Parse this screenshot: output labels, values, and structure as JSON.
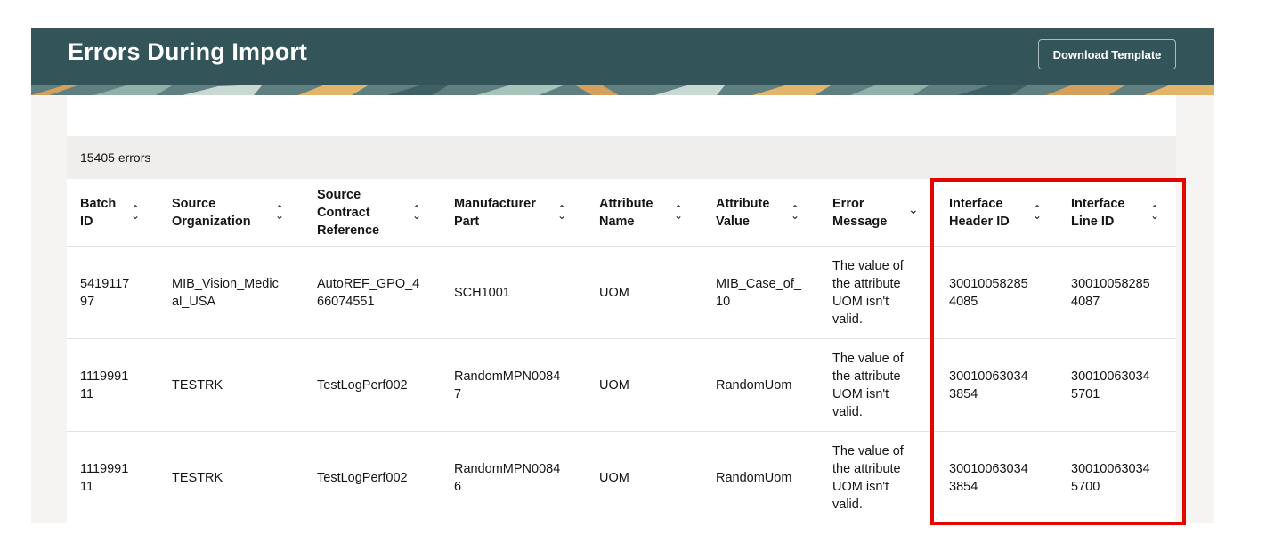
{
  "header": {
    "title": "Errors During Import",
    "download_label": "Download Template"
  },
  "summary": {
    "count_label": "15405 errors"
  },
  "table": {
    "columns": [
      {
        "label": "Batch\nID",
        "sort_icon": "⌃⌄"
      },
      {
        "label": "Source\nOrganization",
        "sort_icon": "⌃⌄"
      },
      {
        "label": "Source\nContract\nReference",
        "sort_icon": "⌃⌄"
      },
      {
        "label": "Manufacturer\nPart",
        "sort_icon": "⌃⌄"
      },
      {
        "label": "Attribute\nName",
        "sort_icon": "⌃⌄"
      },
      {
        "label": "Attribute\nValue",
        "sort_icon": "⌃⌄"
      },
      {
        "label": "Error\nMessage",
        "sort_icon": "⌄"
      },
      {
        "label": "Interface\nHeader ID",
        "sort_icon": "⌃⌄"
      },
      {
        "label": "Interface\nLine ID",
        "sort_icon": "⌃⌄"
      }
    ],
    "rows": [
      [
        "5419117\n97",
        "MIB_Vision_Medic\nal_USA",
        "AutoREF_GPO_4\n66074551",
        "SCH1001",
        "UOM",
        "MIB_Case_of_\n10",
        "The value of\nthe attribute\nUOM isn't\nvalid.",
        "30010058285\n4085",
        "30010058285\n4087"
      ],
      [
        "1119991\n11",
        "TESTRK",
        "TestLogPerf002",
        "RandomMPN0084\n7",
        "UOM",
        "RandomUom",
        "The value of\nthe attribute\nUOM isn't\nvalid.",
        "30010063034\n3854",
        "30010063034\n5701"
      ],
      [
        "1119991\n11",
        "TESTRK",
        "TestLogPerf002",
        "RandomMPN0084\n6",
        "UOM",
        "RandomUom",
        "The value of\nthe attribute\nUOM isn't\nvalid.",
        "30010063034\n3854",
        "30010063034\n5700"
      ]
    ]
  },
  "colors": {
    "header_bg": "#33555a",
    "highlight": "#e10600",
    "count_bar_bg": "#efeeec"
  }
}
